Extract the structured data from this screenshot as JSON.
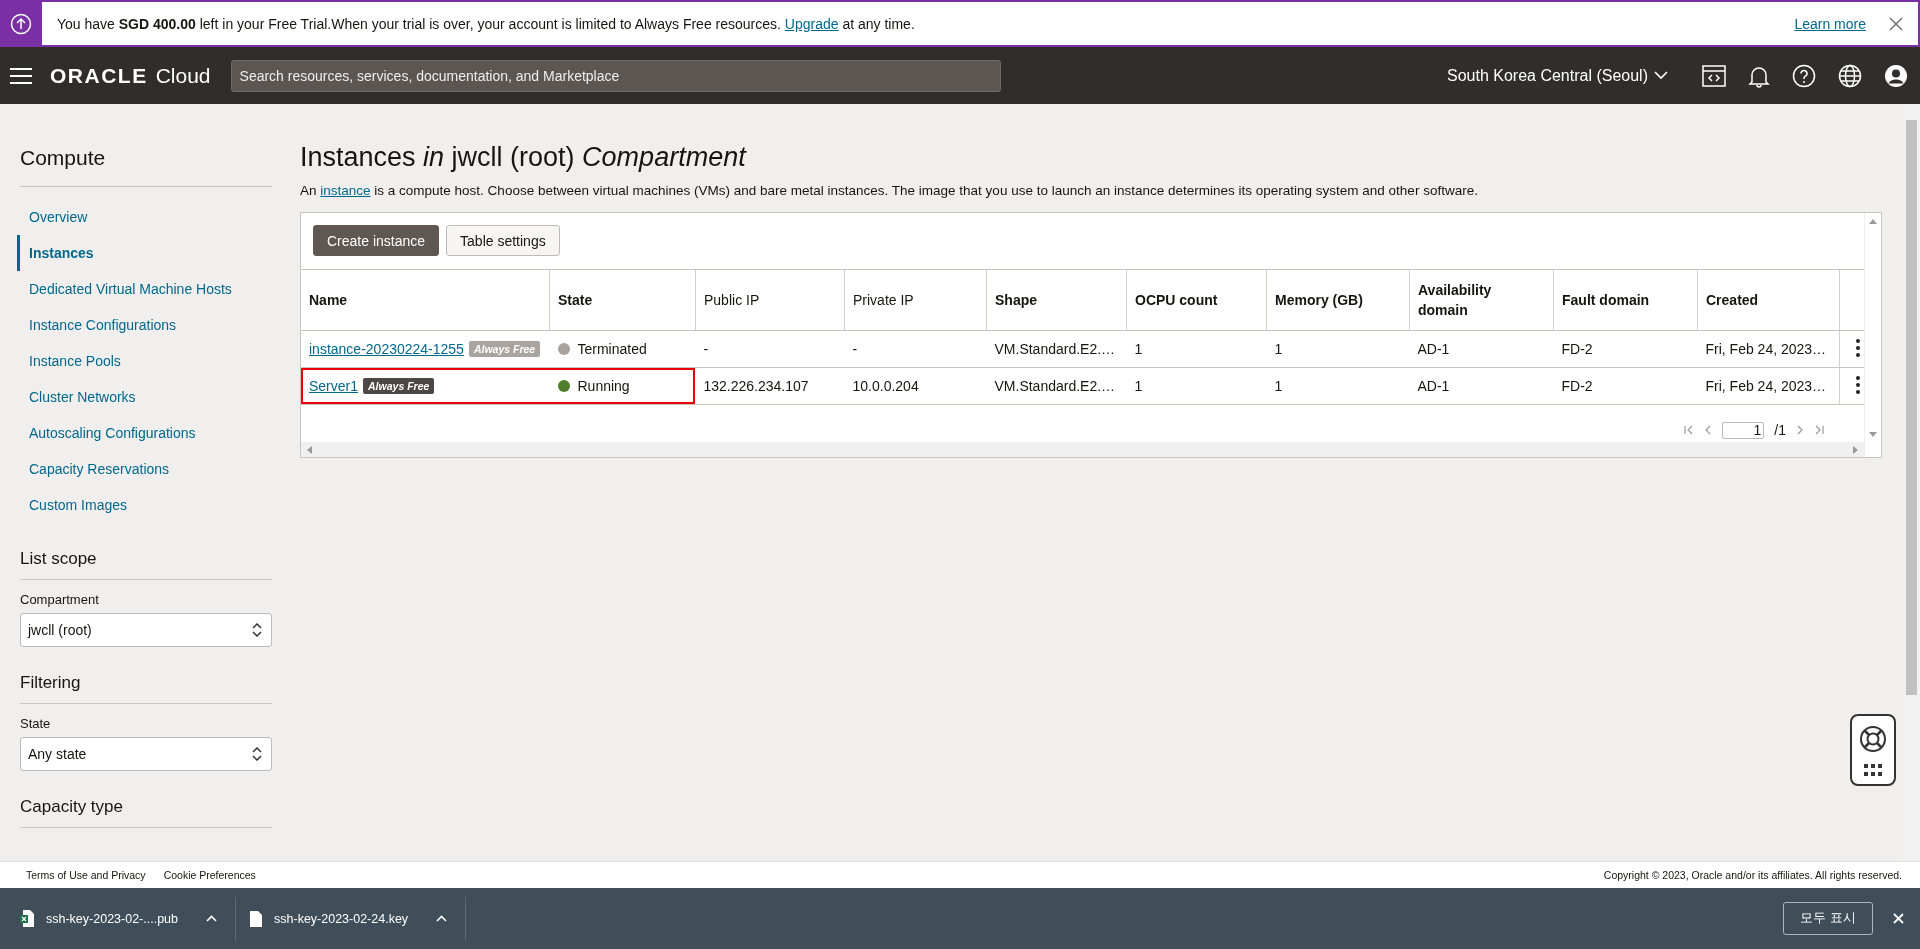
{
  "banner": {
    "text": "You have **SGD 400.00** left in your Free Trial.When your trial is over, your account is limited to Always Free resources. ",
    "link": "Upgrade",
    "after": " at any time.",
    "learn_more": "Learn more"
  },
  "header": {
    "logo": "ORACLE",
    "logo_suffix": "Cloud",
    "search": {
      "placeholder": "Search resources, services, documentation, and Marketplace"
    },
    "region": "South Korea Central (Seoul)"
  },
  "sidebar": {
    "title": "Compute",
    "items": [
      {
        "label": "Overview",
        "selected": false
      },
      {
        "label": "Instances",
        "selected": true
      },
      {
        "label": "Dedicated Virtual Machine Hosts",
        "selected": false
      },
      {
        "label": "Instance Configurations",
        "selected": false
      },
      {
        "label": "Instance Pools",
        "selected": false
      },
      {
        "label": "Cluster Networks",
        "selected": false
      },
      {
        "label": "Autoscaling Configurations",
        "selected": false
      },
      {
        "label": "Capacity Reservations",
        "selected": false
      },
      {
        "label": "Custom Images",
        "selected": false
      }
    ],
    "sections": [
      {
        "title": "List scope",
        "field": {
          "label": "Compartment",
          "value": "jwcll (root)"
        }
      },
      {
        "title": "Filtering",
        "field": {
          "label": "State",
          "value": "Any state"
        }
      },
      {
        "title": "Capacity type"
      }
    ]
  },
  "page": {
    "title": "Instances *in* jwcll (root) *Compartment*",
    "description_before": "An ",
    "description_link": "instance",
    "description_after": " is a compute host. Choose between virtual machines (VMs) and bare metal instances. The image that you use to launch an instance determines its operating system and other software."
  },
  "toolbar": {
    "buttons": [
      {
        "label": "Create instance",
        "kind": "primary"
      },
      {
        "label": "Table settings",
        "kind": "secondary"
      }
    ]
  },
  "table": {
    "columns": [
      {
        "label": "Name",
        "bold": true
      },
      {
        "label": "State",
        "bold": true
      },
      {
        "label": "Public IP",
        "bold": false
      },
      {
        "label": "Private IP",
        "bold": false
      },
      {
        "label": "Shape",
        "bold": true
      },
      {
        "label": "OCPU count",
        "bold": true
      },
      {
        "label": "Memory (GB)",
        "bold": true
      },
      {
        "label": "Availability domain",
        "bold": true
      },
      {
        "label": "Fault domain",
        "bold": true
      },
      {
        "label": "Created",
        "bold": true
      }
    ],
    "rows": [
      {
        "highlighted": false,
        "cells": [
          {
            "link": "instance-20230224-1255",
            "badge": "Always Free",
            "badge_dimmed": true
          },
          {
            "label": "Terminated",
            "color": "#aaa49f"
          },
          "-",
          "-",
          "VM.Standard.E2.…",
          "1",
          "1",
          "AD-1",
          "FD-2",
          "Fri, Feb 24, 2023…"
        ]
      },
      {
        "highlighted": true,
        "cells": [
          {
            "link": "Server1",
            "badge": "Always Free",
            "badge_dimmed": false
          },
          {
            "label": "Running",
            "color": "#4f7d2a"
          },
          "132.226.234.107",
          "10.0.0.204",
          "VM.Standard.E2.…",
          "1",
          "1",
          "AD-1",
          "FD-2",
          "Fri, Feb 24, 2023…"
        ]
      }
    ],
    "pagination": {
      "page": "1",
      "total": "/1"
    }
  },
  "footer": {
    "links": [
      "Terms of Use and Privacy",
      "Cookie Preferences"
    ],
    "copyright": "Copyright © 2023, Oracle and/or its affiliates. All rights reserved."
  },
  "downloads": {
    "items": [
      {
        "name": "ssh-key-2023-02-....pub",
        "kind": "spreadsheet"
      },
      {
        "name": "ssh-key-2023-02-24.key",
        "kind": "file"
      }
    ],
    "show_all": "모두 표시"
  }
}
